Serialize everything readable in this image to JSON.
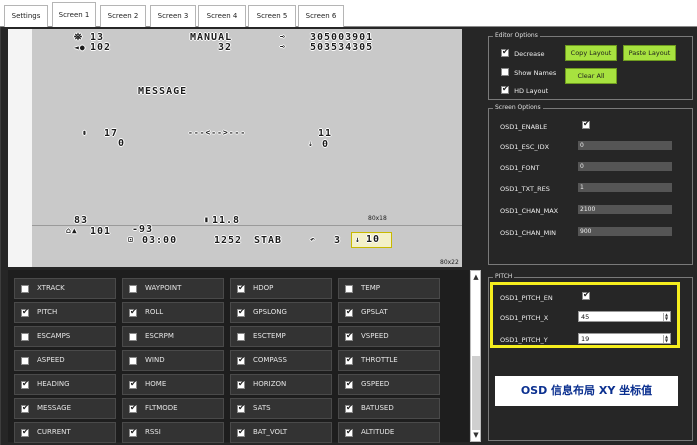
{
  "tabs": [
    "Settings",
    "Screen 1",
    "Screen 2",
    "Screen 3",
    "Screen 4",
    "Screen 5",
    "Screen 6"
  ],
  "active_tab": "Screen 1",
  "osd": {
    "sats": "13",
    "alt_top": "102",
    "mode": "MANUAL",
    "speed_top": "32",
    "lat": "305003901",
    "lon": "503534305",
    "message": "MESSAGE",
    "pitch": "17",
    "roll": "0",
    "horizon": "---<-->---",
    "alt_right": "11",
    "climb": "0",
    "dist": "83",
    "home_dist": "101",
    "temp": "-93",
    "time": "03:00",
    "batused": "1252",
    "flightmode": "STAB",
    "wp": "3",
    "heading_box": "10",
    "voltage": "11.8",
    "res_top": "80x18",
    "res_bottom": "80x22"
  },
  "elements": [
    {
      "label": "XTRACK",
      "on": false
    },
    {
      "label": "WAYPOINT",
      "on": false
    },
    {
      "label": "HDOP",
      "on": true
    },
    {
      "label": "TEMP",
      "on": false
    },
    {
      "label": "PITCH",
      "on": true
    },
    {
      "label": "ROLL",
      "on": true
    },
    {
      "label": "GPSLONG",
      "on": true
    },
    {
      "label": "GPSLAT",
      "on": true
    },
    {
      "label": "ESCAMPS",
      "on": false
    },
    {
      "label": "ESCRPM",
      "on": false
    },
    {
      "label": "ESCTEMP",
      "on": false
    },
    {
      "label": "VSPEED",
      "on": true
    },
    {
      "label": "ASPEED",
      "on": false
    },
    {
      "label": "WIND",
      "on": false
    },
    {
      "label": "COMPASS",
      "on": true
    },
    {
      "label": "THROTTLE",
      "on": true
    },
    {
      "label": "HEADING",
      "on": true
    },
    {
      "label": "HOME",
      "on": true
    },
    {
      "label": "HORIZON",
      "on": true
    },
    {
      "label": "GSPEED",
      "on": true
    },
    {
      "label": "MESSAGE",
      "on": true
    },
    {
      "label": "FLTMODE",
      "on": true
    },
    {
      "label": "SATS",
      "on": true
    },
    {
      "label": "BATUSED",
      "on": true
    },
    {
      "label": "CURRENT",
      "on": true
    },
    {
      "label": "RSSI",
      "on": true
    },
    {
      "label": "BAT_VOLT",
      "on": true
    },
    {
      "label": "ALTITUDE",
      "on": true
    }
  ],
  "editor_options": {
    "legend": "Editor Options",
    "decrease": "Decrease",
    "show_names": "Show Names",
    "hd_layout": "HD Layout",
    "copy_layout": "Copy Layout",
    "paste_layout": "Paste Layout",
    "clear_all": "Clear All"
  },
  "screen_options": {
    "legend": "Screen Options",
    "rows": [
      {
        "label": "OSD1_ENABLE",
        "value": ""
      },
      {
        "label": "OSD1_ESC_IDX",
        "value": "0"
      },
      {
        "label": "OSD1_FONT",
        "value": "0"
      },
      {
        "label": "OSD1_TXT_RES",
        "value": "1"
      },
      {
        "label": "OSD1_CHAN_MAX",
        "value": "2100"
      },
      {
        "label": "OSD1_CHAN_MIN",
        "value": "900"
      }
    ]
  },
  "pitch": {
    "legend": "PITCH",
    "en_label": "OSD1_PITCH_EN",
    "x_label": "OSD1_PITCH_X",
    "x_value": "45",
    "y_label": "OSD1_PITCH_Y",
    "y_value": "19"
  },
  "caption": "OSD 信息布局 XY 坐标值",
  "colors": {
    "accent_green": "#a7e23f",
    "highlight_yellow": "#f5ee1e",
    "caption_text": "#0a2f8f"
  }
}
